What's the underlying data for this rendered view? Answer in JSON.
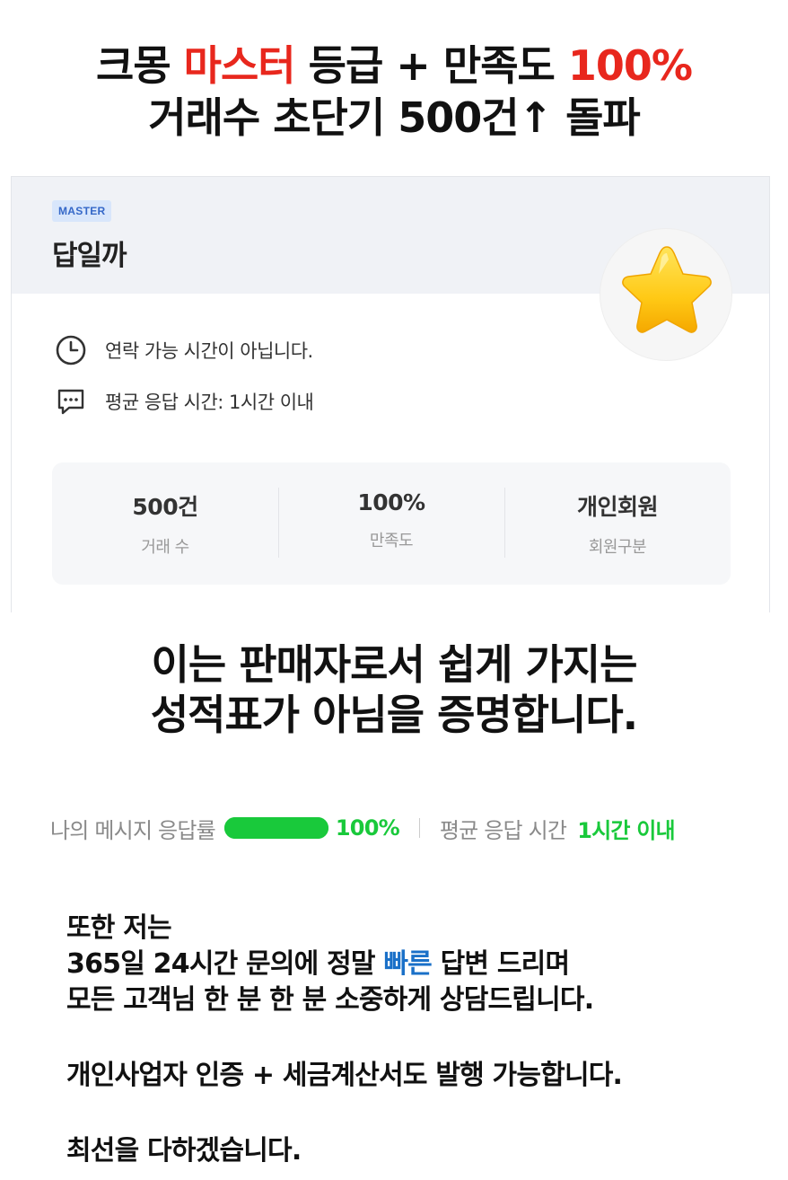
{
  "headline": {
    "line1_a": "크몽 ",
    "line1_red1": "마스터",
    "line1_b": " 등급 + 만족도 ",
    "line1_red2": "100%",
    "line2": "거래수 초단기 500건↑ 돌파"
  },
  "profile": {
    "badge": "MASTER",
    "name": "답일까",
    "avatar_icon": "star-icon",
    "contact_status": "연락 가능 시간이 아닙니다.",
    "avg_response": "평균 응답 시간: 1시간 이내"
  },
  "stats": [
    {
      "value": "500건",
      "label": "거래 수"
    },
    {
      "value": "100%",
      "label": "만족도"
    },
    {
      "value": "개인회원",
      "label": "회원구분"
    }
  ],
  "middle": {
    "line1": "이는 판매자로서 쉽게 가지는",
    "line2": "성적표가 아님을 증명합니다."
  },
  "response": {
    "rate_label": "나의 메시지 응답률",
    "rate_fraction": 1.0,
    "rate_value": "100%",
    "time_label": "평균 응답 시간",
    "time_value": "1시간 이내"
  },
  "body": {
    "line1": "또한 저는",
    "line2_a": "365일 24시간 문의에 정말 ",
    "line2_blue": "빠른",
    "line2_b": " 답변 드리며",
    "line3": "모든 고객님 한 분 한 분 소중하게 상담드립니다.",
    "line4": "개인사업자 인증 + 세금계산서도 발행 가능합니다.",
    "line5": "최선을 다하겠습니다."
  },
  "colors": {
    "accent_red": "#e8271d",
    "accent_green": "#19c93b",
    "accent_blue": "#1a70c8",
    "badge_blue": "#3568c8"
  }
}
